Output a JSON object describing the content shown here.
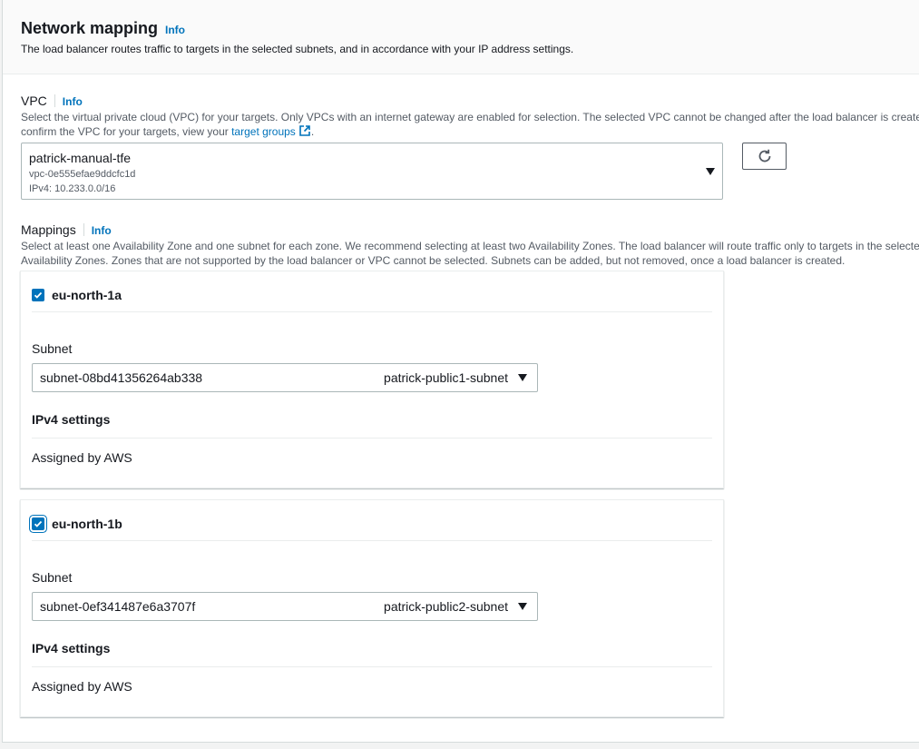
{
  "header": {
    "title": "Network mapping",
    "info": "Info",
    "description": "The load balancer routes traffic to targets in the selected subnets, and in accordance with your IP address settings."
  },
  "vpc": {
    "label": "VPC",
    "info": "Info",
    "description_line1": "Select the virtual private cloud (VPC) for your targets. Only VPCs with an internet gateway are enabled for selection. The selected VPC cannot be changed after the load balancer is created. To",
    "description_line2_prefix": "confirm the VPC for your targets, view your ",
    "description_link": "target groups",
    "description_line2_suffix": ".",
    "selected": {
      "name": "patrick-manual-tfe",
      "id": "vpc-0e555efae9ddcfc1d",
      "cidr": "IPv4: 10.233.0.0/16"
    }
  },
  "mappings": {
    "label": "Mappings",
    "info": "Info",
    "description_line1": "Select at least one Availability Zone and one subnet for each zone. We recommend selecting at least two Availability Zones. The load balancer will route traffic only to targets in the selected",
    "description_line2": "Availability Zones. Zones that are not supported by the load balancer or VPC cannot be selected. Subnets can be added, but not removed, once a load balancer is created.",
    "zones": [
      {
        "name": "eu-north-1a",
        "checked": true,
        "subnet_label": "Subnet",
        "subnet_id": "subnet-08bd41356264ab338",
        "subnet_name": "patrick-public1-subnet",
        "ipv4_heading": "IPv4 settings",
        "ipv4_value": "Assigned by AWS"
      },
      {
        "name": "eu-north-1b",
        "checked": true,
        "subnet_label": "Subnet",
        "subnet_id": "subnet-0ef341487e6a3707f",
        "subnet_name": "patrick-public2-subnet",
        "ipv4_heading": "IPv4 settings",
        "ipv4_value": "Assigned by AWS"
      }
    ]
  },
  "colors": {
    "link": "#0073bb",
    "checkbox": "#0073bb",
    "text": "#16191f",
    "muted": "#545b64"
  }
}
